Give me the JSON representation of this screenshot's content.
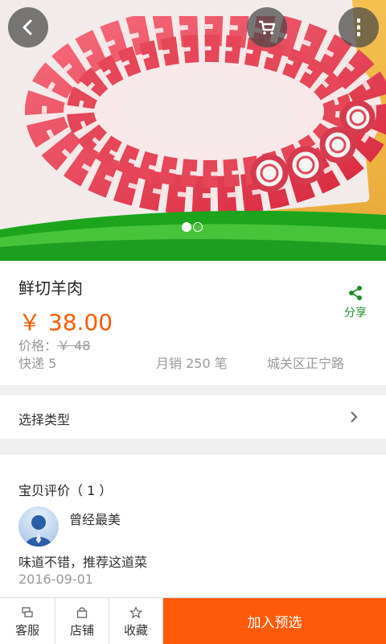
{
  "gallery": {
    "current_slide": 1,
    "total_slides": 2
  },
  "header": {
    "back_icon": "chevron-left-icon",
    "cart_icon": "cart-icon",
    "more_icon": "more-vertical-icon"
  },
  "product": {
    "title": "鲜切羊肉",
    "price": "￥ 38.00",
    "orig_label": "价格：",
    "orig_price": "￥ 48",
    "shipping": "快递 5",
    "monthly_sales": "月销 250 笔",
    "location": "城关区正宁路",
    "share_label": "分享"
  },
  "options": {
    "select_type_label": "选择类型"
  },
  "reviews": {
    "title": "宝贝评价（ 1 ）",
    "items": [
      {
        "user": "曾经最美",
        "text": "味道不错，推荐这道菜",
        "date": "2016-09-01"
      }
    ]
  },
  "bottom_bar": {
    "service_label": "客服",
    "store_label": "店铺",
    "favorite_label": "收藏",
    "add_button_label": "加入预选"
  },
  "colors": {
    "accent": "#ff5a00",
    "share_green": "#1f8b2b"
  }
}
